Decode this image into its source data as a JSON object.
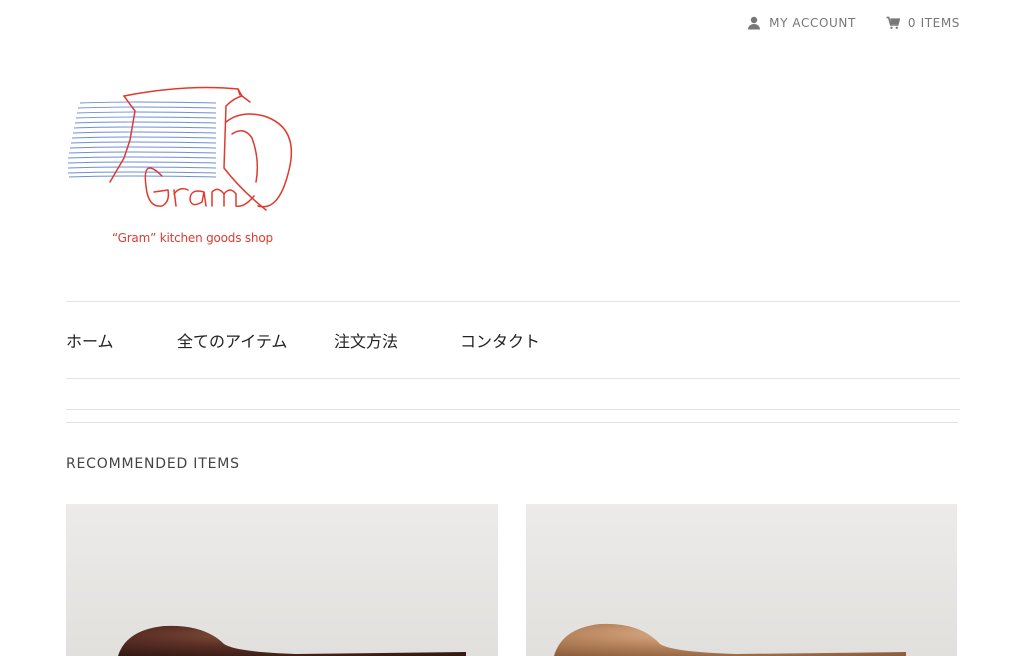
{
  "header": {
    "account_label": "MY ACCOUNT",
    "cart_label": "0 ITEMS"
  },
  "logo": {
    "tagline": "“Gram” kitchen goods shop",
    "wordmark": "Gram"
  },
  "nav": {
    "items": [
      {
        "label": "ホーム"
      },
      {
        "label": "全てのアイテム"
      },
      {
        "label": "注文方法"
      },
      {
        "label": "コンタクト"
      }
    ]
  },
  "recommended": {
    "title": "RECOMMENDED ITEMS"
  },
  "colors": {
    "logo_red": "#e03a2e",
    "logo_blue": "#6b8fd6",
    "spoon_dark": "#5a2f25",
    "spoon_light": "#b9865e"
  }
}
